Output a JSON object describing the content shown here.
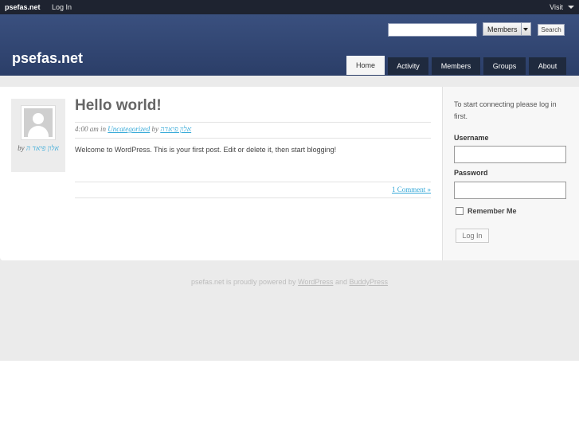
{
  "adminbar": {
    "site": "psefas.net",
    "login": "Log In",
    "visit": "Visit"
  },
  "header": {
    "title": "psefas.net",
    "search": {
      "value": "",
      "select": "Members",
      "button": "Search"
    },
    "nav": [
      "Home",
      "Activity",
      "Members",
      "Groups",
      "About"
    ],
    "active_tab": "Home"
  },
  "post": {
    "title": "Hello world!",
    "meta": {
      "time": "4:00 am",
      "in": "in",
      "category": "Uncategorized",
      "by": "by",
      "author": "אלון פיאדה"
    },
    "author_box": {
      "by": "by",
      "name": "אלון פיאד ה"
    },
    "body": "Welcome to WordPress. This is your first post. Edit or delete it, then start blogging!",
    "comments": "1 Comment »"
  },
  "sidebar": {
    "intro": "To start connecting please log in first.",
    "username_label": "Username",
    "password_label": "Password",
    "remember_label": "Remember Me",
    "login_button": "Log In"
  },
  "footer": {
    "text": "psefas.net is proudly powered by",
    "link1": "WordPress",
    "and": "and",
    "link2": "BuddyPress"
  },
  "colors": {
    "header": "#34497a",
    "adminbar": "#1e2330",
    "link": "#36a9d8",
    "nav_tab": "#1f2a3e"
  }
}
